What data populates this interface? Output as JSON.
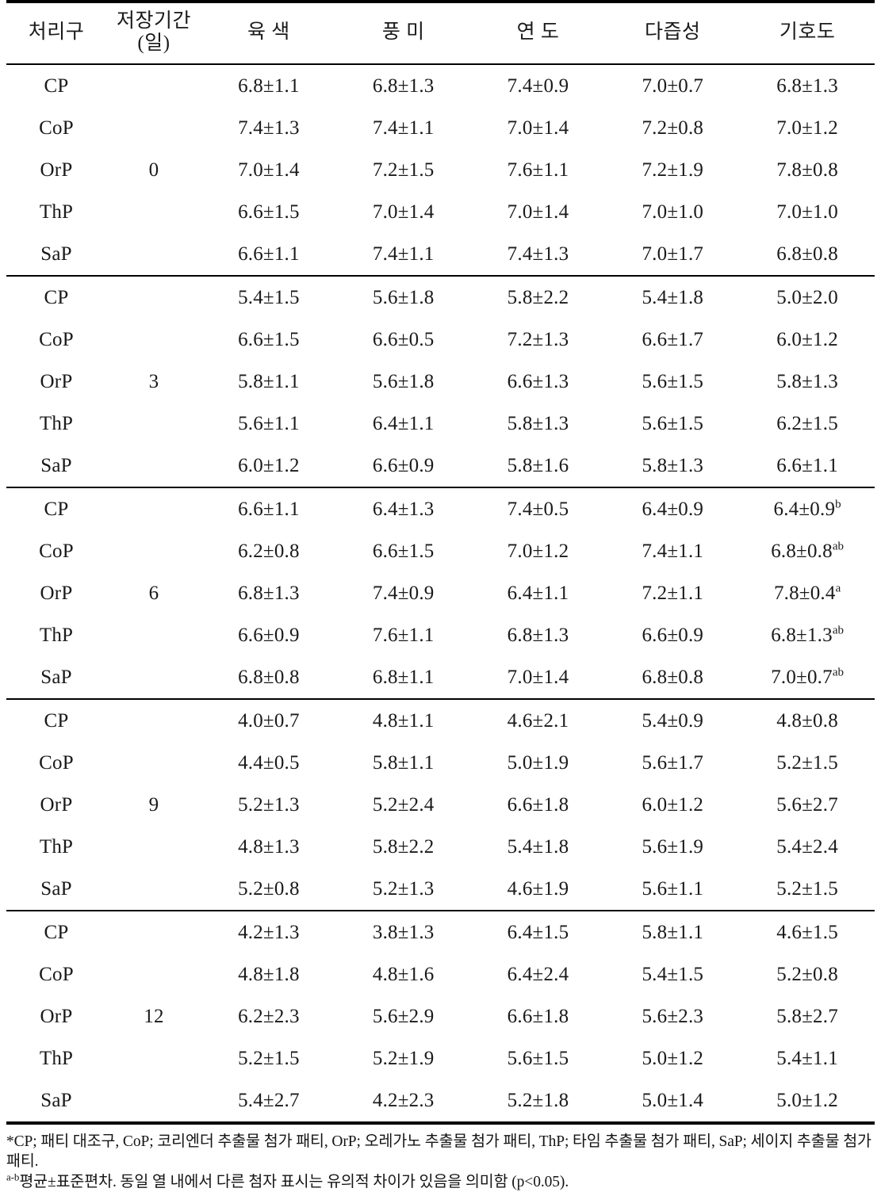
{
  "table": {
    "columns": [
      {
        "key": "treatment",
        "label": "처리구"
      },
      {
        "key": "days",
        "label_line1": "저장기간",
        "label_line2": "(일)"
      },
      {
        "key": "meat_color",
        "label": "육 색"
      },
      {
        "key": "flavor",
        "label": "풍 미"
      },
      {
        "key": "tenderness",
        "label": "연 도"
      },
      {
        "key": "juiciness",
        "label": "다즙성"
      },
      {
        "key": "overall",
        "label": "기호도"
      }
    ],
    "blocks": [
      {
        "days": "0",
        "rows": [
          {
            "treatment": "CP",
            "meat_color": "6.8±1.1",
            "flavor": "6.8±1.3",
            "tenderness": "7.4±0.9",
            "juiciness": "7.0±0.7",
            "overall": "6.8±1.3",
            "overall_sup": ""
          },
          {
            "treatment": "CoP",
            "meat_color": "7.4±1.3",
            "flavor": "7.4±1.1",
            "tenderness": "7.0±1.4",
            "juiciness": "7.2±0.8",
            "overall": "7.0±1.2",
            "overall_sup": ""
          },
          {
            "treatment": "OrP",
            "meat_color": "7.0±1.4",
            "flavor": "7.2±1.5",
            "tenderness": "7.6±1.1",
            "juiciness": "7.2±1.9",
            "overall": "7.8±0.8",
            "overall_sup": ""
          },
          {
            "treatment": "ThP",
            "meat_color": "6.6±1.5",
            "flavor": "7.0±1.4",
            "tenderness": "7.0±1.4",
            "juiciness": "7.0±1.0",
            "overall": "7.0±1.0",
            "overall_sup": ""
          },
          {
            "treatment": "SaP",
            "meat_color": "6.6±1.1",
            "flavor": "7.4±1.1",
            "tenderness": "7.4±1.3",
            "juiciness": "7.0±1.7",
            "overall": "6.8±0.8",
            "overall_sup": ""
          }
        ]
      },
      {
        "days": "3",
        "rows": [
          {
            "treatment": "CP",
            "meat_color": "5.4±1.5",
            "flavor": "5.6±1.8",
            "tenderness": "5.8±2.2",
            "juiciness": "5.4±1.8",
            "overall": "5.0±2.0",
            "overall_sup": ""
          },
          {
            "treatment": "CoP",
            "meat_color": "6.6±1.5",
            "flavor": "6.6±0.5",
            "tenderness": "7.2±1.3",
            "juiciness": "6.6±1.7",
            "overall": "6.0±1.2",
            "overall_sup": ""
          },
          {
            "treatment": "OrP",
            "meat_color": "5.8±1.1",
            "flavor": "5.6±1.8",
            "tenderness": "6.6±1.3",
            "juiciness": "5.6±1.5",
            "overall": "5.8±1.3",
            "overall_sup": ""
          },
          {
            "treatment": "ThP",
            "meat_color": "5.6±1.1",
            "flavor": "6.4±1.1",
            "tenderness": "5.8±1.3",
            "juiciness": "5.6±1.5",
            "overall": "6.2±1.5",
            "overall_sup": ""
          },
          {
            "treatment": "SaP",
            "meat_color": "6.0±1.2",
            "flavor": "6.6±0.9",
            "tenderness": "5.8±1.6",
            "juiciness": "5.8±1.3",
            "overall": "6.6±1.1",
            "overall_sup": ""
          }
        ]
      },
      {
        "days": "6",
        "rows": [
          {
            "treatment": "CP",
            "meat_color": "6.6±1.1",
            "flavor": "6.4±1.3",
            "tenderness": "7.4±0.5",
            "juiciness": "6.4±0.9",
            "overall": "6.4±0.9",
            "overall_sup": "b"
          },
          {
            "treatment": "CoP",
            "meat_color": "6.2±0.8",
            "flavor": "6.6±1.5",
            "tenderness": "7.0±1.2",
            "juiciness": "7.4±1.1",
            "overall": "6.8±0.8",
            "overall_sup": "ab"
          },
          {
            "treatment": "OrP",
            "meat_color": "6.8±1.3",
            "flavor": "7.4±0.9",
            "tenderness": "6.4±1.1",
            "juiciness": "7.2±1.1",
            "overall": "7.8±0.4",
            "overall_sup": "a"
          },
          {
            "treatment": "ThP",
            "meat_color": "6.6±0.9",
            "flavor": "7.6±1.1",
            "tenderness": "6.8±1.3",
            "juiciness": "6.6±0.9",
            "overall": "6.8±1.3",
            "overall_sup": "ab"
          },
          {
            "treatment": "SaP",
            "meat_color": "6.8±0.8",
            "flavor": "6.8±1.1",
            "tenderness": "7.0±1.4",
            "juiciness": "6.8±0.8",
            "overall": "7.0±0.7",
            "overall_sup": "ab"
          }
        ]
      },
      {
        "days": "9",
        "rows": [
          {
            "treatment": "CP",
            "meat_color": "4.0±0.7",
            "flavor": "4.8±1.1",
            "tenderness": "4.6±2.1",
            "juiciness": "5.4±0.9",
            "overall": "4.8±0.8",
            "overall_sup": ""
          },
          {
            "treatment": "CoP",
            "meat_color": "4.4±0.5",
            "flavor": "5.8±1.1",
            "tenderness": "5.0±1.9",
            "juiciness": "5.6±1.7",
            "overall": "5.2±1.5",
            "overall_sup": ""
          },
          {
            "treatment": "OrP",
            "meat_color": "5.2±1.3",
            "flavor": "5.2±2.4",
            "tenderness": "6.6±1.8",
            "juiciness": "6.0±1.2",
            "overall": "5.6±2.7",
            "overall_sup": ""
          },
          {
            "treatment": "ThP",
            "meat_color": "4.8±1.3",
            "flavor": "5.8±2.2",
            "tenderness": "5.4±1.8",
            "juiciness": "5.6±1.9",
            "overall": "5.4±2.4",
            "overall_sup": ""
          },
          {
            "treatment": "SaP",
            "meat_color": "5.2±0.8",
            "flavor": "5.2±1.3",
            "tenderness": "4.6±1.9",
            "juiciness": "5.6±1.1",
            "overall": "5.2±1.5",
            "overall_sup": ""
          }
        ]
      },
      {
        "days": "12",
        "rows": [
          {
            "treatment": "CP",
            "meat_color": "4.2±1.3",
            "flavor": "3.8±1.3",
            "tenderness": "6.4±1.5",
            "juiciness": "5.8±1.1",
            "overall": "4.6±1.5",
            "overall_sup": ""
          },
          {
            "treatment": "CoP",
            "meat_color": "4.8±1.8",
            "flavor": "4.8±1.6",
            "tenderness": "6.4±2.4",
            "juiciness": "5.4±1.5",
            "overall": "5.2±0.8",
            "overall_sup": ""
          },
          {
            "treatment": "OrP",
            "meat_color": "6.2±2.3",
            "flavor": "5.6±2.9",
            "tenderness": "6.6±1.8",
            "juiciness": "5.6±2.3",
            "overall": "5.8±2.7",
            "overall_sup": ""
          },
          {
            "treatment": "ThP",
            "meat_color": "5.2±1.5",
            "flavor": "5.2±1.9",
            "tenderness": "5.6±1.5",
            "juiciness": "5.0±1.2",
            "overall": "5.4±1.1",
            "overall_sup": ""
          },
          {
            "treatment": "SaP",
            "meat_color": "5.4±2.7",
            "flavor": "4.2±2.3",
            "tenderness": "5.2±1.8",
            "juiciness": "5.0±1.4",
            "overall": "5.0±1.2",
            "overall_sup": ""
          }
        ]
      }
    ]
  },
  "footnotes": {
    "line1": "*CP; 패티 대조구, CoP; 코리엔더 추출물 첨가 패티, OrP; 오레가노 추출물 첨가 패티, ThP; 타임 추출물 첨가 패티, SaP; 세이지 추출물 첨가 패티.",
    "line2_sup": "a-b",
    "line2": "평균±표준편차. 동일 열 내에서 다른 첨자 표시는 유의적 차이가 있음을 의미함 (p<0.05)."
  }
}
